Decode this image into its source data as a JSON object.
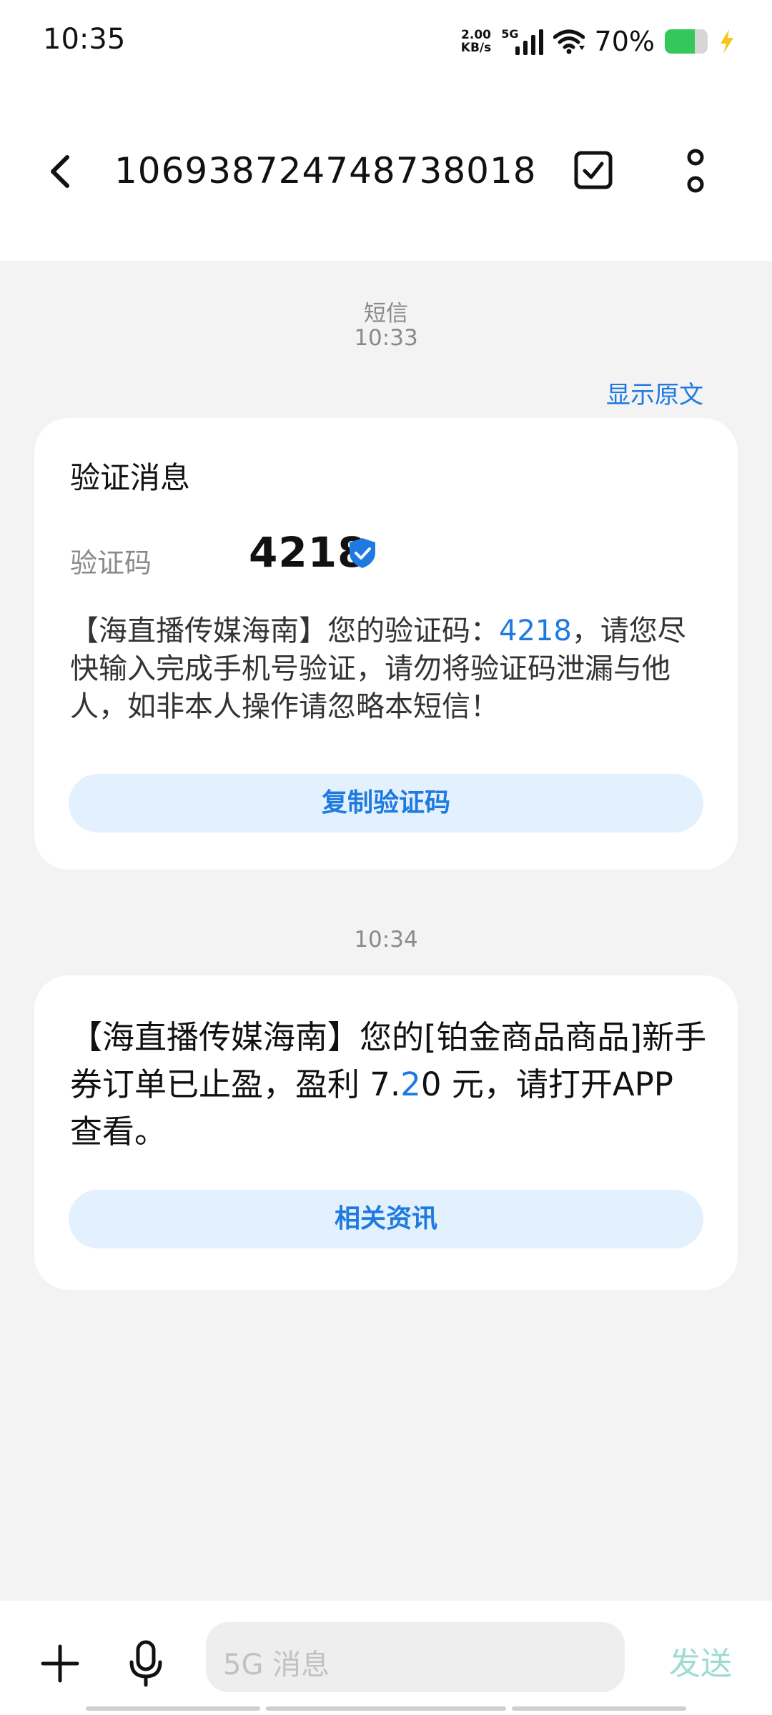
{
  "status_bar": {
    "time": "10:35",
    "net_speed_value": "2.00",
    "net_speed_unit": "KB/s",
    "signal_label": "5G",
    "battery_percent": "70%",
    "battery_level": 0.7,
    "battery_color": "#34c759"
  },
  "header": {
    "title": "106938724748738018",
    "back_icon": "chevron-left-icon",
    "select_icon": "checkbox-icon",
    "more_icon": "more-vertical-icon"
  },
  "conversation": {
    "msg1": {
      "type_label": "短信",
      "time": "10:33",
      "show_original": "显示原文",
      "card_title": "验证消息",
      "code_label": "验证码",
      "code_value": "4218",
      "body_before": "【海直播传媒海南】您的验证码：",
      "body_code": "4218",
      "body_after": "，请您尽快输入完成手机号验证，请勿将验证码泄漏与他人，如非本人操作请忽略本短信！",
      "action_label": "复制验证码"
    },
    "msg2": {
      "time": "10:34",
      "body_before": "【海直播传媒海南】您的[铂金商品商品]新手券订单已止盈，盈利 7.",
      "body_highlight": "2",
      "body_after": "0 元，请打开APP 查看。",
      "action_label": "相关资讯"
    }
  },
  "composer": {
    "input_placeholder": "5G 消息",
    "send_label": "发送",
    "plus_icon": "plus-icon",
    "mic_icon": "microphone-icon"
  },
  "colors": {
    "accent": "#1e7ae0",
    "pill_bg": "#e3f0fd",
    "send_disabled": "#9fdcd0"
  }
}
